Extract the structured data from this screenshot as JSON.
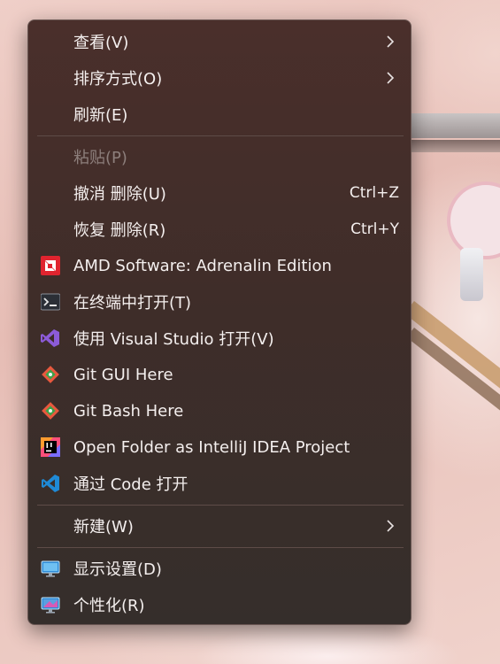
{
  "context_menu": {
    "items": [
      {
        "label": "查看(V)",
        "shortcut": "",
        "submenu": true,
        "disabled": false,
        "icon": ""
      },
      {
        "label": "排序方式(O)",
        "shortcut": "",
        "submenu": true,
        "disabled": false,
        "icon": ""
      },
      {
        "label": "刷新(E)",
        "shortcut": "",
        "submenu": false,
        "disabled": false,
        "icon": ""
      },
      {
        "label": "粘贴(P)",
        "shortcut": "",
        "submenu": false,
        "disabled": true,
        "icon": ""
      },
      {
        "label": "撤消 删除(U)",
        "shortcut": "Ctrl+Z",
        "submenu": false,
        "disabled": false,
        "icon": ""
      },
      {
        "label": "恢复 删除(R)",
        "shortcut": "Ctrl+Y",
        "submenu": false,
        "disabled": false,
        "icon": ""
      },
      {
        "label": "AMD Software: Adrenalin Edition",
        "shortcut": "",
        "submenu": false,
        "disabled": false,
        "icon": "amd-logo-icon"
      },
      {
        "label": "在终端中打开(T)",
        "shortcut": "",
        "submenu": false,
        "disabled": false,
        "icon": "terminal-icon"
      },
      {
        "label": "使用 Visual Studio 打开(V)",
        "shortcut": "",
        "submenu": false,
        "disabled": false,
        "icon": "visual-studio-icon"
      },
      {
        "label": "Git GUI Here",
        "shortcut": "",
        "submenu": false,
        "disabled": false,
        "icon": "git-gui-icon"
      },
      {
        "label": "Git Bash Here",
        "shortcut": "",
        "submenu": false,
        "disabled": false,
        "icon": "git-bash-icon"
      },
      {
        "label": "Open Folder as IntelliJ IDEA Project",
        "shortcut": "",
        "submenu": false,
        "disabled": false,
        "icon": "intellij-idea-icon"
      },
      {
        "label": "通过 Code 打开",
        "shortcut": "",
        "submenu": false,
        "disabled": false,
        "icon": "vscode-icon"
      },
      {
        "label": "新建(W)",
        "shortcut": "",
        "submenu": true,
        "disabled": false,
        "icon": ""
      },
      {
        "label": "显示设置(D)",
        "shortcut": "",
        "submenu": false,
        "disabled": false,
        "icon": "display-settings-icon"
      },
      {
        "label": "个性化(R)",
        "shortcut": "",
        "submenu": false,
        "disabled": false,
        "icon": "personalize-icon"
      }
    ]
  },
  "colors": {
    "menu_background": "#3f2d29",
    "text": "#f4efee",
    "disabled_text": "#8d7f7c",
    "separator": "#5e4c48"
  }
}
